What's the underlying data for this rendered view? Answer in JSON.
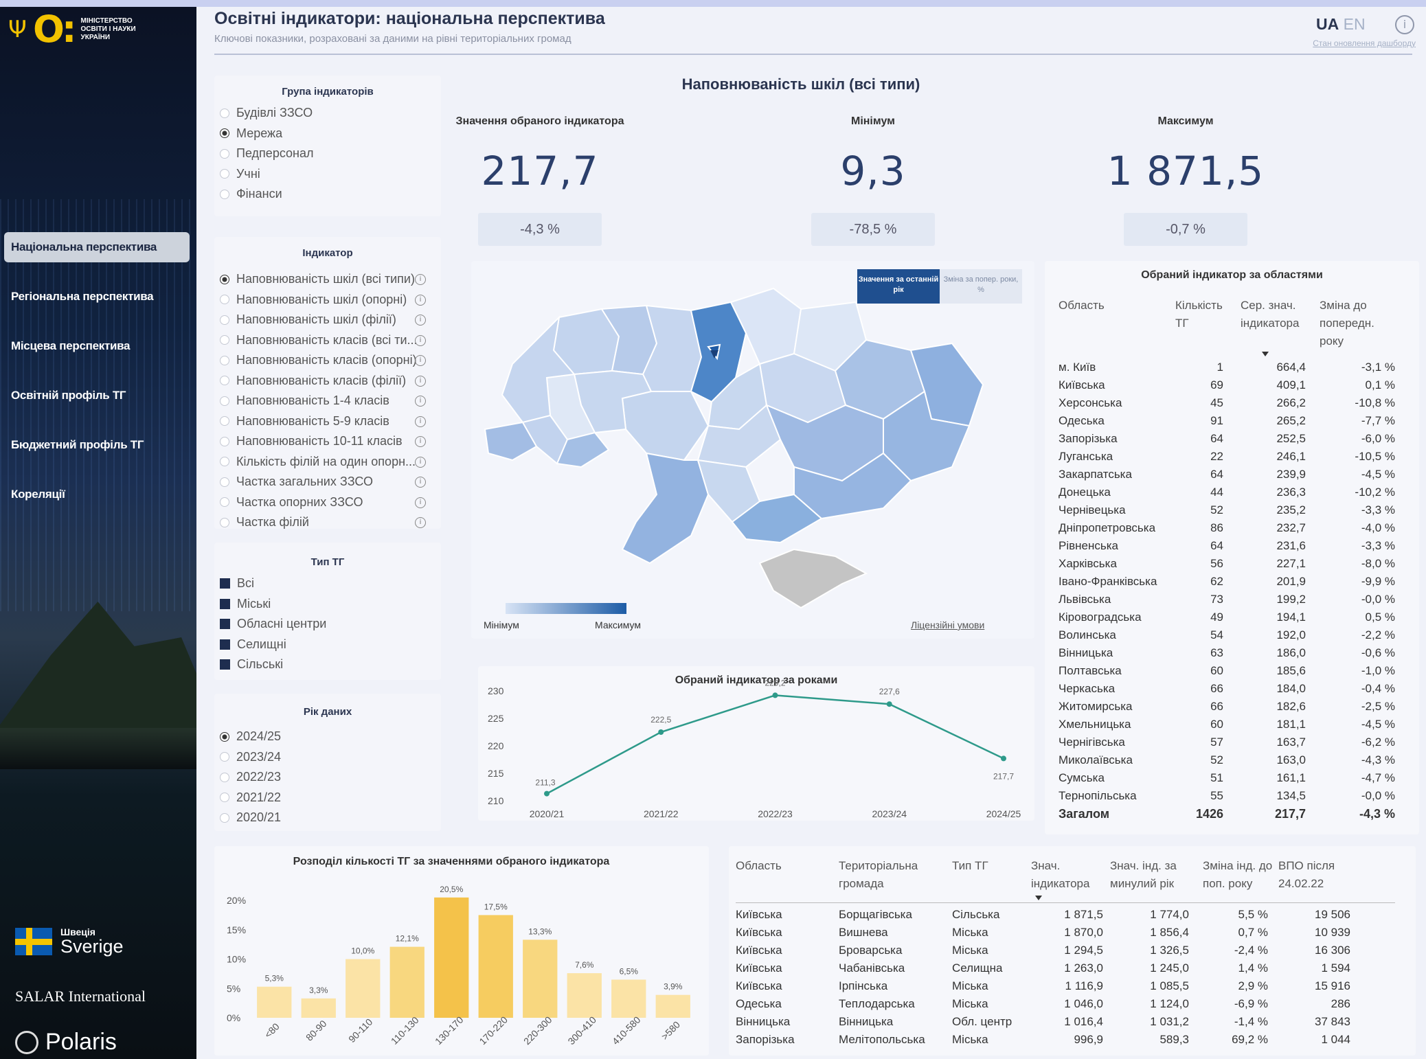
{
  "header": {
    "title": "Освітні індикатори: національна перспектива",
    "subtitle": "Ключові показники, розраховані за даними на рівні територіальних громад",
    "lang_ua": "UA",
    "lang_en": "EN",
    "info_icon": "info-icon",
    "dashboard_link": "Стан оновлення дашборду"
  },
  "sidebar": {
    "ministry_text": "МІНІСТЕРСТВО ОСВІТИ І НАУКИ УКРАЇНИ",
    "nav": [
      {
        "label": "Національна перспектива",
        "active": true
      },
      {
        "label": "Регіональна перспектива",
        "active": false
      },
      {
        "label": "Місцева перспектива",
        "active": false
      },
      {
        "label": "Освітній профіль ТГ",
        "active": false
      },
      {
        "label": "Бюджетний профіль ТГ",
        "active": false
      },
      {
        "label": "Кореляції",
        "active": false
      }
    ],
    "sponsors": {
      "sweden_small": "Швеція",
      "sweden_big": "Sverige",
      "salar": "SALAR International",
      "polaris": "Polaris"
    }
  },
  "filters": {
    "group_title": "Група індикаторів",
    "groups": [
      {
        "label": "Будівлі ЗЗСО",
        "selected": false
      },
      {
        "label": "Мережа",
        "selected": true
      },
      {
        "label": "Педперсонал",
        "selected": false
      },
      {
        "label": "Учні",
        "selected": false
      },
      {
        "label": "Фінанси",
        "selected": false
      }
    ],
    "indicator_title": "Індикатор",
    "indicators": [
      {
        "label": "Наповнюваність шкіл (всі типи)",
        "selected": true
      },
      {
        "label": "Наповнюваність шкіл (опорні)",
        "selected": false
      },
      {
        "label": "Наповнюваність шкіл (філії)",
        "selected": false
      },
      {
        "label": "Наповнюваність класів (всі ти...",
        "selected": false
      },
      {
        "label": "Наповнюваність класів (опорні)",
        "selected": false
      },
      {
        "label": "Наповнюваність класів (філії)",
        "selected": false
      },
      {
        "label": "Наповнюваність 1-4 класів",
        "selected": false
      },
      {
        "label": "Наповнюваність 5-9 класів",
        "selected": false
      },
      {
        "label": "Наповнюваність 10-11 класів",
        "selected": false
      },
      {
        "label": "Кількість філій на один опорн...",
        "selected": false
      },
      {
        "label": "Частка загальних ЗЗСО",
        "selected": false
      },
      {
        "label": "Частка опорних ЗЗСО",
        "selected": false
      },
      {
        "label": "Частка філій",
        "selected": false
      }
    ],
    "tg_type_title": "Тип ТГ",
    "tg_types": [
      "Всі",
      "Міські",
      "Обласні центри",
      "Селищні",
      "Сільські"
    ],
    "year_title": "Рік даних",
    "years": [
      {
        "label": "2024/25",
        "selected": true
      },
      {
        "label": "2023/24",
        "selected": false
      },
      {
        "label": "2022/23",
        "selected": false
      },
      {
        "label": "2021/22",
        "selected": false
      },
      {
        "label": "2020/21",
        "selected": false
      }
    ]
  },
  "dashboard": {
    "title": "Наповнюваність шкіл (всі типи)",
    "kpis": [
      {
        "title": "Значення обраного індикатора",
        "value": "217,7",
        "change": "-4,3 %"
      },
      {
        "title": "Мінімум",
        "value": "9,3",
        "change": "-78,5 %"
      },
      {
        "title": "Максимум",
        "value": "1 871,5",
        "change": "-0,7 %"
      }
    ],
    "map": {
      "btn_last_year": "Значення за останній рік",
      "btn_change": "Зміна за попер. роки, %",
      "legend_min": "Мінімум",
      "legend_max": "Максимум",
      "license": "Ліцензійні умови",
      "colors": {
        "light": "#d7e3f5",
        "mid": "#86aad9",
        "dark": "#3f7cc2",
        "crimea": "#c4c4c4"
      }
    }
  },
  "region_table": {
    "title": "Обраний індикатор за областями",
    "headers": [
      "Область",
      "Кількість ТГ",
      "Сер. знач. індикатора",
      "Зміна до попередн. року"
    ],
    "rows": [
      [
        "м. Київ",
        "1",
        "664,4",
        "-3,1 %"
      ],
      [
        "Київська",
        "69",
        "409,1",
        "0,1 %"
      ],
      [
        "Херсонська",
        "45",
        "266,2",
        "-10,8 %"
      ],
      [
        "Одеська",
        "91",
        "265,2",
        "-7,7 %"
      ],
      [
        "Запорізька",
        "64",
        "252,5",
        "-6,0 %"
      ],
      [
        "Луганська",
        "22",
        "246,1",
        "-10,5 %"
      ],
      [
        "Закарпатська",
        "64",
        "239,9",
        "-4,5 %"
      ],
      [
        "Донецька",
        "44",
        "236,3",
        "-10,2 %"
      ],
      [
        "Чернівецька",
        "52",
        "235,2",
        "-3,3 %"
      ],
      [
        "Дніпропетровська",
        "86",
        "232,7",
        "-4,0 %"
      ],
      [
        "Рівненська",
        "64",
        "231,6",
        "-3,3 %"
      ],
      [
        "Харківська",
        "56",
        "227,1",
        "-8,0 %"
      ],
      [
        "Івано-Франківська",
        "62",
        "201,9",
        "-9,9 %"
      ],
      [
        "Львівська",
        "73",
        "199,2",
        "-0,0 %"
      ],
      [
        "Кіровоградська",
        "49",
        "194,1",
        "0,5 %"
      ],
      [
        "Волинська",
        "54",
        "192,0",
        "-2,2 %"
      ],
      [
        "Вінницька",
        "63",
        "186,0",
        "-0,6 %"
      ],
      [
        "Полтавська",
        "60",
        "185,6",
        "-1,0 %"
      ],
      [
        "Черкаська",
        "66",
        "184,0",
        "-0,4 %"
      ],
      [
        "Житомирська",
        "66",
        "182,6",
        "-2,5 %"
      ],
      [
        "Хмельницька",
        "60",
        "181,1",
        "-4,5 %"
      ],
      [
        "Чернігівська",
        "57",
        "163,7",
        "-6,2 %"
      ],
      [
        "Миколаївська",
        "52",
        "163,0",
        "-4,3 %"
      ],
      [
        "Сумська",
        "51",
        "161,1",
        "-4,7 %"
      ],
      [
        "Тернопільська",
        "55",
        "134,5",
        "-0,0 %"
      ]
    ],
    "total": [
      "Загалом",
      "1426",
      "217,7",
      "-4,3 %"
    ]
  },
  "tg_table": {
    "headers": [
      "Область",
      "Територіальна громада",
      "Тип ТГ",
      "Знач. індикатора",
      "Знач. інд. за минулий рік",
      "Зміна інд. до поп. року",
      "ВПО після 24.02.22"
    ],
    "rows": [
      [
        "Київська",
        "Борщагівська",
        "Сільська",
        "1 871,5",
        "1 774,0",
        "5,5 %",
        "19 506"
      ],
      [
        "Київська",
        "Вишнева",
        "Міська",
        "1 870,0",
        "1 856,4",
        "0,7 %",
        "10 939"
      ],
      [
        "Київська",
        "Броварська",
        "Міська",
        "1 294,5",
        "1 326,5",
        "-2,4 %",
        "16 306"
      ],
      [
        "Київська",
        "Чабанівська",
        "Селищна",
        "1 263,0",
        "1 245,0",
        "1,4 %",
        "1 594"
      ],
      [
        "Київська",
        "Ірпінська",
        "Міська",
        "1 116,9",
        "1 085,5",
        "2,9 %",
        "15 916"
      ],
      [
        "Одеська",
        "Теплодарська",
        "Міська",
        "1 046,0",
        "1 124,0",
        "-6,9 %",
        "286"
      ],
      [
        "Вінницька",
        "Вінницька",
        "Обл. центр",
        "1 016,4",
        "1 031,2",
        "-1,4 %",
        "37 843"
      ],
      [
        "Запорізька",
        "Мелітопольська",
        "Міська",
        "996,9",
        "589,3",
        "69,2 %",
        "1 044"
      ]
    ]
  },
  "chart_data": [
    {
      "type": "line",
      "title": "Обраний індикатор за роками",
      "x": [
        "2020/21",
        "2021/22",
        "2022/23",
        "2023/24",
        "2024/25"
      ],
      "values": [
        211.3,
        222.5,
        229.2,
        227.6,
        217.7
      ],
      "labels": [
        "211,3",
        "222,5",
        "229,2",
        "227,6",
        "217,7"
      ],
      "yticks": [
        210,
        215,
        220,
        225,
        230
      ],
      "ylim": [
        210,
        230
      ],
      "color": "#2e9a8a"
    },
    {
      "type": "bar",
      "title": "Розподіл кількості ТГ за значеннями обраного індикатора",
      "categories": [
        "<80",
        "80-90",
        "90-110",
        "110-130",
        "130-170",
        "170-220",
        "220-300",
        "300-410",
        "410-580",
        ">580"
      ],
      "values": [
        5.3,
        3.3,
        10.0,
        12.1,
        20.5,
        17.5,
        13.3,
        7.6,
        6.5,
        3.9
      ],
      "labels": [
        "5,3%",
        "3,3%",
        "10,0%",
        "12,1%",
        "20,5%",
        "17,5%",
        "13,3%",
        "7,6%",
        "6,5%",
        "3,9%"
      ],
      "yticks": [
        "0%",
        "5%",
        "10%",
        "15%",
        "20%"
      ],
      "ylim": [
        0,
        22
      ],
      "colors": [
        "#fbe3a6",
        "#fbe3a6",
        "#fbe3a6",
        "#f8d77f",
        "#f4c24a",
        "#f6cc60",
        "#f8d77f",
        "#fbe3a6",
        "#fbe3a6",
        "#fbe3a6"
      ]
    }
  ]
}
